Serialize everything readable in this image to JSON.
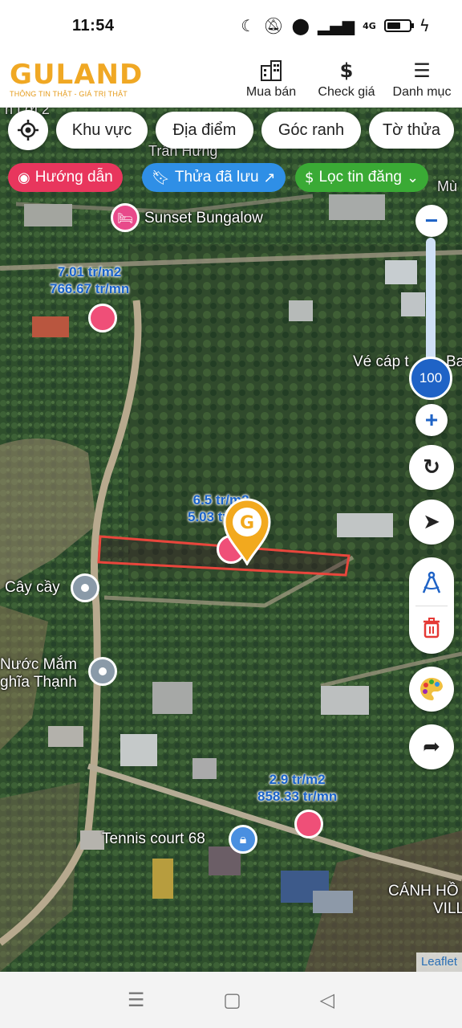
{
  "status_bar": {
    "time": "11:54",
    "icons": [
      "moon-icon",
      "mute-icon",
      "location-icon",
      "signal-icon",
      "4g-signal-icon",
      "battery-icon",
      "charging-icon"
    ],
    "network_label": "4G"
  },
  "header": {
    "logo_text": "GULAND",
    "logo_tagline": "THÔNG TIN THẬT - GIÁ TRỊ THẬT",
    "brand_color": "#f0a824",
    "menu": [
      {
        "label": "Mua bán",
        "icon": "building-icon"
      },
      {
        "label": "Check giá",
        "icon": "dollar-icon"
      },
      {
        "label": "Danh mục",
        "icon": "hamburger-icon"
      }
    ]
  },
  "filters": {
    "chips": [
      "Khu vực",
      "Địa điểm",
      "Góc ranh",
      "Tờ thửa"
    ],
    "pills": [
      {
        "label": "Hướng dẫn",
        "icon": "play-circle-icon",
        "color": "#e8365d"
      },
      {
        "label": "Thửa đã lưu",
        "icon": "bookmark-icon",
        "trailing_icon": "external-arrow-icon",
        "color": "#2f8fe6"
      },
      {
        "label": "Lọc tin đăng",
        "icon": "dollar-icon",
        "trailing_icon": "chevron-down-icon",
        "color": "#3aaa35"
      }
    ]
  },
  "map": {
    "place_labels": [
      "Sunset Bungalow",
      "Cây cầy",
      "Nước Mắm",
      "ghĩa Thạnh",
      "Tennis court 68",
      "Vé cáp t",
      "Ba",
      "CÁNH HỒ",
      "VILLA",
      "Trần Hưng",
      "n Lợi 2",
      "Mù"
    ],
    "listings": [
      {
        "price_m2": "7.01 tr/m2",
        "price_total": "766.67 tr/mn"
      },
      {
        "price_m2": "6.5 tr/m2",
        "price_total": "5.03 tỷ/mn"
      },
      {
        "price_m2": "2.9 tr/m2",
        "price_total": "858.33 tr/mn"
      }
    ],
    "zoom_level": "100",
    "zoom_fraction": 0.15,
    "attribution": "Leaflet",
    "selected_parcel_color": "#e8463c"
  },
  "controls": {
    "zoom_out": "−",
    "zoom_in": "+",
    "right_buttons": [
      "refresh-icon",
      "navigate-icon",
      "compass-draw-icon",
      "trash-icon",
      "palette-icon",
      "share-icon"
    ]
  },
  "navbar": {
    "buttons": [
      "recent-apps-icon",
      "home-icon",
      "back-icon"
    ]
  }
}
